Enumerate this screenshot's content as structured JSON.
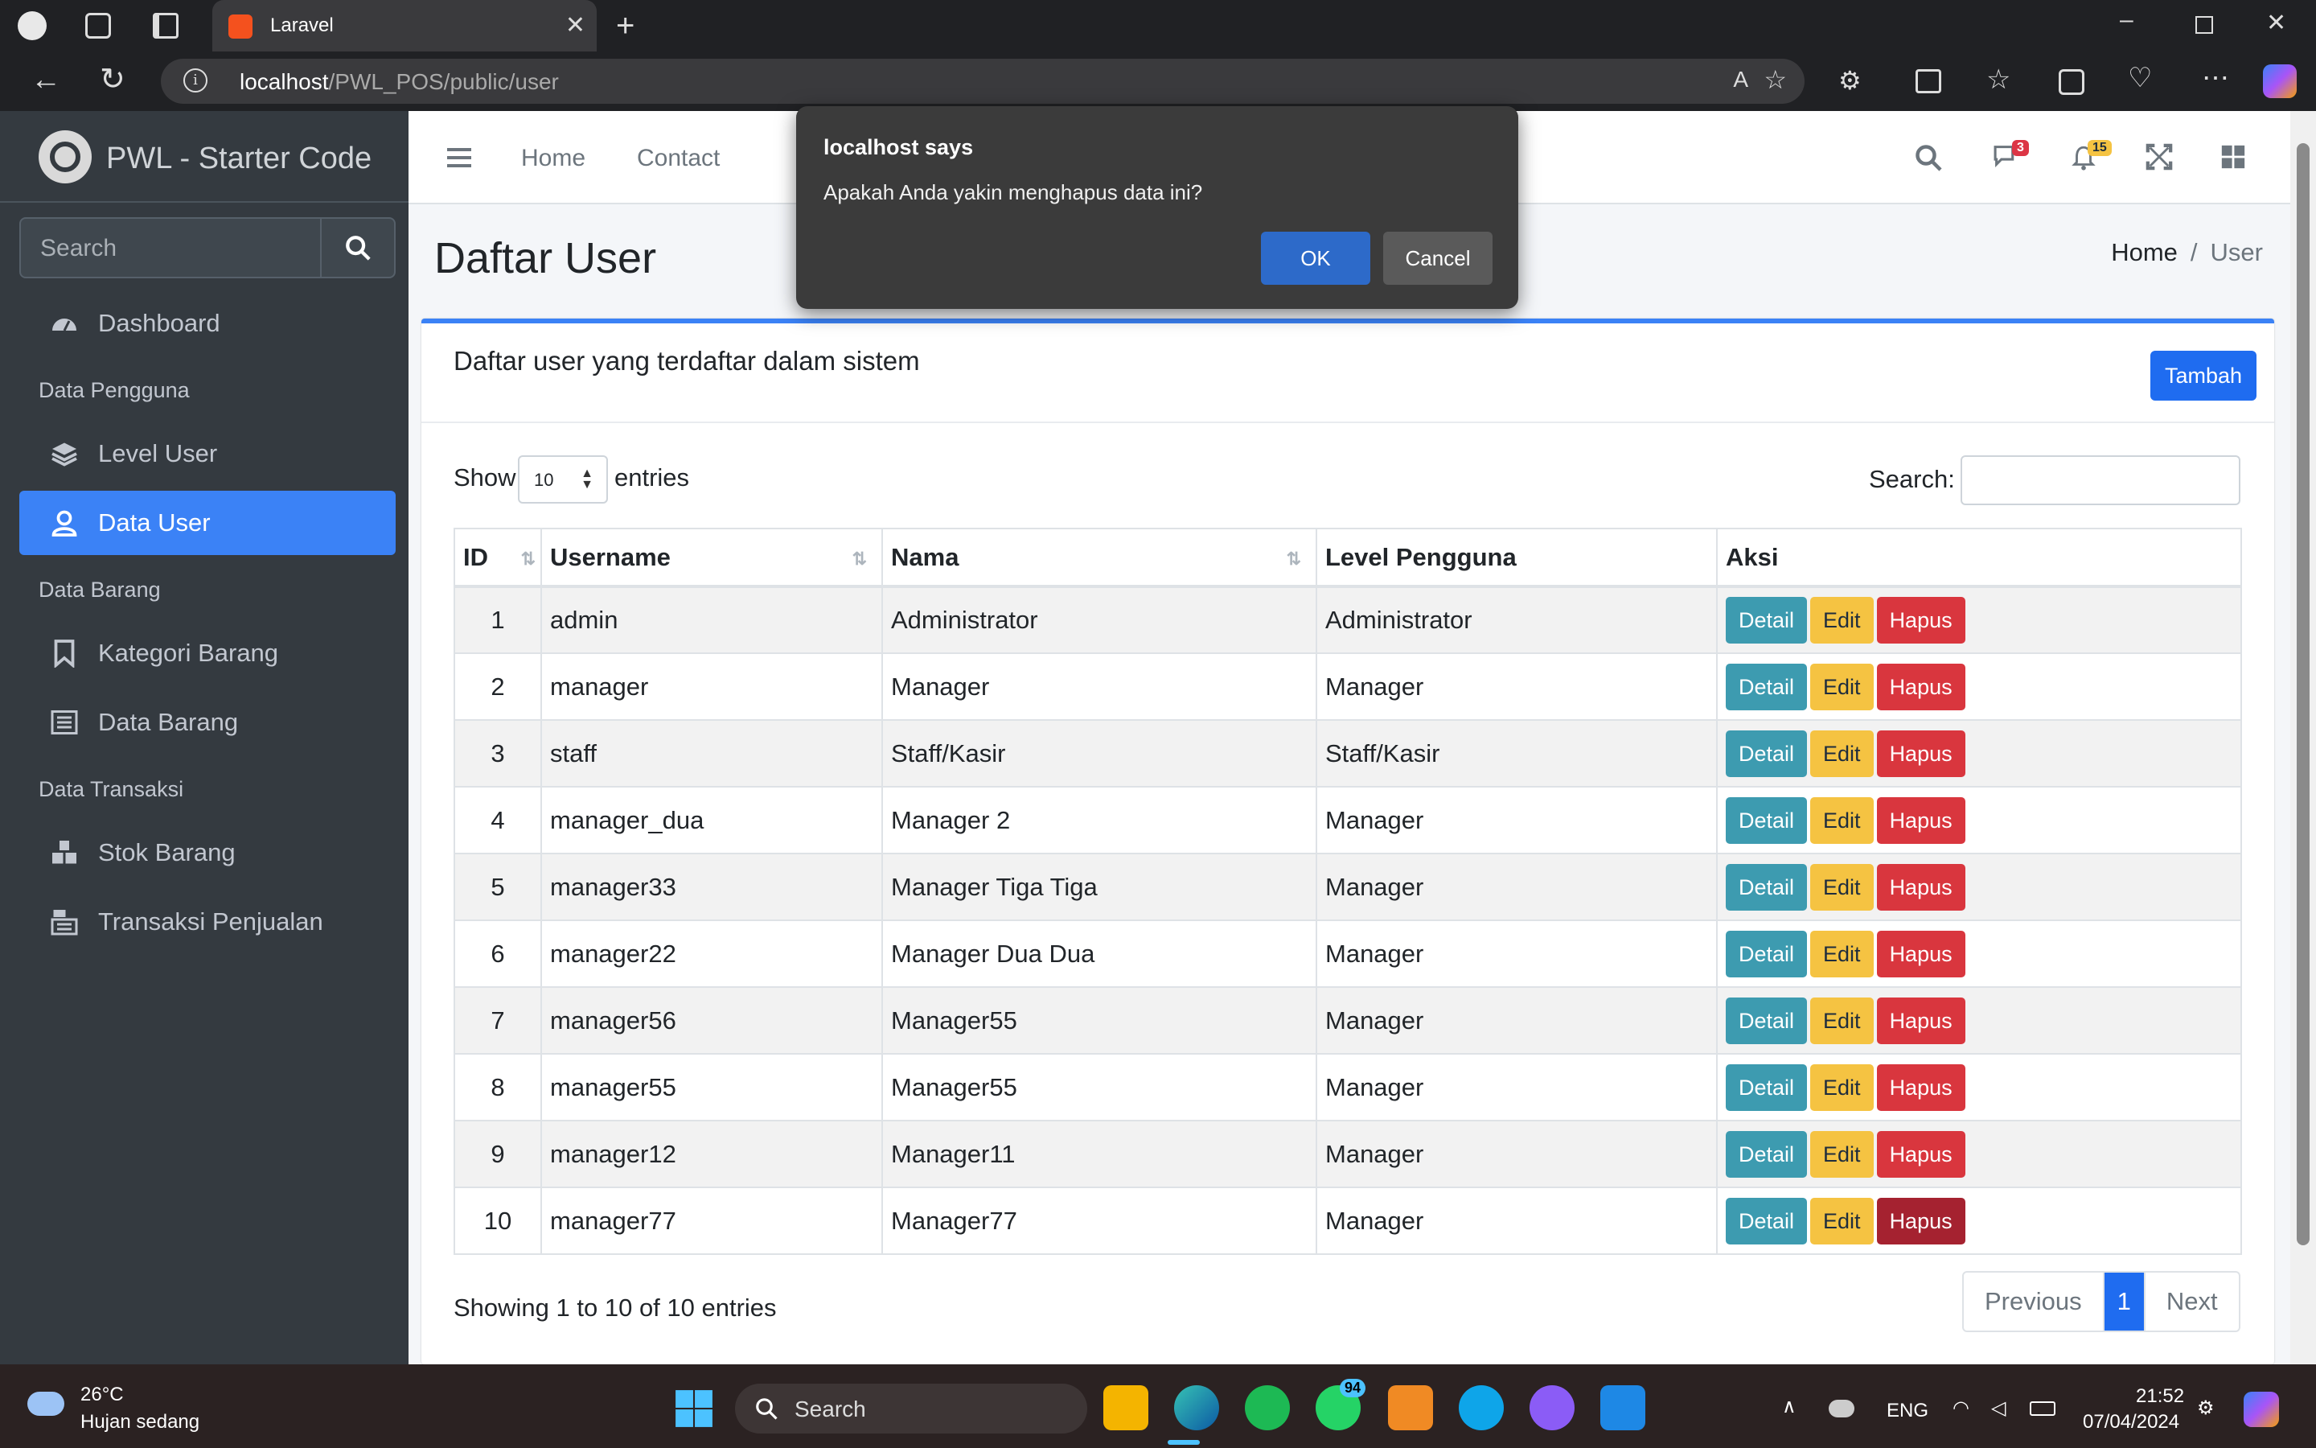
{
  "browser": {
    "tab_title": "Laravel",
    "url_host": "localhost",
    "url_path": "/PWL_POS/public/user"
  },
  "sidebar": {
    "brand": "PWL - Starter Code",
    "search_placeholder": "Search",
    "items": [
      {
        "label": "Dashboard",
        "icon": "dashboard-icon"
      },
      {
        "header": "Data Pengguna"
      },
      {
        "label": "Level User",
        "icon": "layers-icon"
      },
      {
        "label": "Data User",
        "icon": "user-icon",
        "active": true
      },
      {
        "header": "Data Barang"
      },
      {
        "label": "Kategori Barang",
        "icon": "bookmark-icon"
      },
      {
        "label": "Data Barang",
        "icon": "list-icon"
      },
      {
        "header": "Data Transaksi"
      },
      {
        "label": "Stok Barang",
        "icon": "cubes-icon"
      },
      {
        "label": "Transaksi Penjualan",
        "icon": "cash-register-icon"
      }
    ]
  },
  "topnav": {
    "home": "Home",
    "contact": "Contact",
    "messages_badge": "3",
    "notifications_badge": "15"
  },
  "page": {
    "title": "Daftar User",
    "breadcrumb_home": "Home",
    "breadcrumb_current": "User"
  },
  "card": {
    "title": "Daftar user yang terdaftar dalam sistem",
    "add_button": "Tambah",
    "show_label": "Show",
    "page_length": "10",
    "entries_label": "entries",
    "search_label": "Search:",
    "columns": [
      "ID",
      "Username",
      "Nama",
      "Level Pengguna",
      "Aksi"
    ],
    "rows": [
      {
        "id": "1",
        "username": "admin",
        "nama": "Administrator",
        "level": "Administrator"
      },
      {
        "id": "2",
        "username": "manager",
        "nama": "Manager",
        "level": "Manager"
      },
      {
        "id": "3",
        "username": "staff",
        "nama": "Staff/Kasir",
        "level": "Staff/Kasir"
      },
      {
        "id": "4",
        "username": "manager_dua",
        "nama": "Manager 2",
        "level": "Manager"
      },
      {
        "id": "5",
        "username": "manager33",
        "nama": "Manager Tiga Tiga",
        "level": "Manager"
      },
      {
        "id": "6",
        "username": "manager22",
        "nama": "Manager Dua Dua",
        "level": "Manager"
      },
      {
        "id": "7",
        "username": "manager56",
        "nama": "Manager55",
        "level": "Manager"
      },
      {
        "id": "8",
        "username": "manager55",
        "nama": "Manager55",
        "level": "Manager"
      },
      {
        "id": "9",
        "username": "manager12",
        "nama": "Manager11",
        "level": "Manager"
      },
      {
        "id": "10",
        "username": "manager77",
        "nama": "Manager77",
        "level": "Manager"
      }
    ],
    "action_labels": {
      "detail": "Detail",
      "edit": "Edit",
      "delete": "Hapus"
    },
    "showing_text": "Showing 1 to 10 of 10 entries",
    "pagination": {
      "previous": "Previous",
      "current": "1",
      "next": "Next"
    }
  },
  "dialog": {
    "title": "localhost says",
    "message": "Apakah Anda yakin menghapus data ini?",
    "ok": "OK",
    "cancel": "Cancel"
  },
  "taskbar": {
    "temperature": "26°C",
    "weather": "Hujan sedang",
    "search_placeholder": "Search",
    "whatsapp_badge": "94",
    "language": "ENG",
    "time": "21:52",
    "date": "07/04/2024"
  },
  "colors": {
    "primary": "#3b82f6",
    "sidebar_bg": "#343a40",
    "info": "#3d9bb0",
    "warning": "#f5c342",
    "danger": "#d9363e"
  }
}
